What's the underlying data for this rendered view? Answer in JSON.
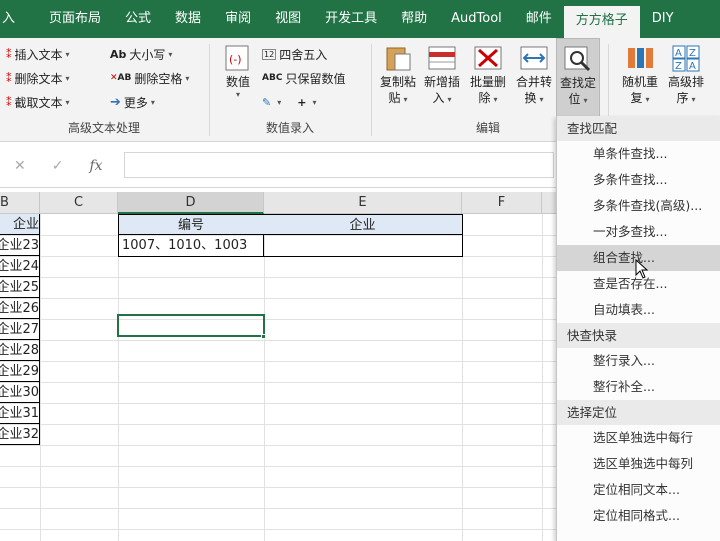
{
  "tabs": [
    {
      "label": "入"
    },
    {
      "label": "页面布局"
    },
    {
      "label": "公式"
    },
    {
      "label": "数据"
    },
    {
      "label": "审阅"
    },
    {
      "label": "视图"
    },
    {
      "label": "开发工具"
    },
    {
      "label": "帮助"
    },
    {
      "label": "AudTool"
    },
    {
      "label": "邮件"
    },
    {
      "label": "方方格子",
      "active": true
    },
    {
      "label": "DIY"
    }
  ],
  "ribbon": {
    "text_group": {
      "label": "高级文本处理",
      "col1": [
        {
          "label": "插入文本"
        },
        {
          "label": "删除文本"
        },
        {
          "label": "截取文本"
        }
      ],
      "col2": [
        {
          "label": "大小写"
        },
        {
          "label": "删除空格"
        },
        {
          "label": "更多"
        }
      ]
    },
    "value_group": {
      "label": "数值录入",
      "big_label": "数值",
      "round": "四舍五入",
      "keep_value": "只保留数值"
    },
    "edit_group": {
      "label": "编辑",
      "btns": [
        {
          "l1": "复制粘",
          "l2": "贴"
        },
        {
          "l1": "新增插",
          "l2": "入"
        },
        {
          "l1": "批量删",
          "l2": "除"
        },
        {
          "l1": "合并转",
          "l2": "换"
        },
        {
          "l1": "查找定",
          "l2": "位"
        }
      ]
    },
    "extra": [
      {
        "l1": "随机重",
        "l2": "复"
      },
      {
        "l1": "高级排",
        "l2": "序"
      }
    ]
  },
  "formula_bar": {
    "value": ""
  },
  "columns": [
    "B",
    "C",
    "D",
    "E",
    "F"
  ],
  "cells": {
    "b_header": "企业",
    "b_values": [
      "企业23",
      "企业24",
      "企业25",
      "企业26",
      "企业27",
      "企业28",
      "企业29",
      "企业30",
      "企业31",
      "企业32"
    ],
    "d_header": "编号",
    "e_header": "企业",
    "d_value": "1007、1010、1003"
  },
  "menu": {
    "sections": [
      {
        "title": "查找匹配",
        "items": [
          {
            "label": "单条件查找..."
          },
          {
            "label": "多条件查找..."
          },
          {
            "label": "多条件查找(高级)..."
          },
          {
            "label": "一对多查找..."
          },
          {
            "label": "组合查找...",
            "highlight": true
          },
          {
            "label": "查是否存在..."
          },
          {
            "label": "自动填表..."
          }
        ]
      },
      {
        "title": "快查快录",
        "items": [
          {
            "label": "整行录入..."
          },
          {
            "label": "整行补全..."
          }
        ]
      },
      {
        "title": "选择定位",
        "items": [
          {
            "label": "选区单独选中每行"
          },
          {
            "label": "选区单独选中每列"
          },
          {
            "label": "定位相同文本..."
          },
          {
            "label": "定位相同格式..."
          }
        ]
      }
    ]
  }
}
